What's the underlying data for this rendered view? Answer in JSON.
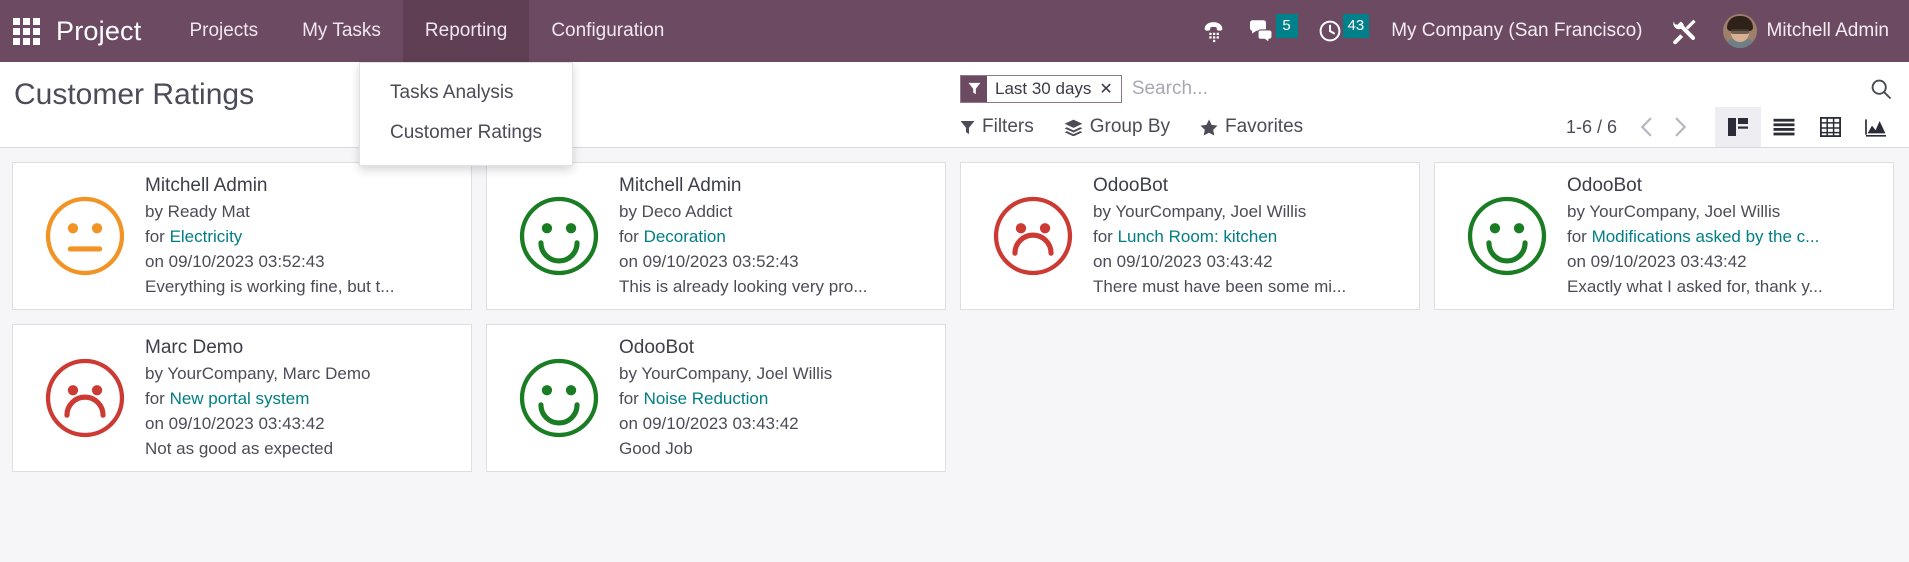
{
  "navbar": {
    "apps_icon": "apps-grid-icon",
    "brand": "Project",
    "menus": [
      {
        "label": "Projects",
        "active": false
      },
      {
        "label": "My Tasks",
        "active": false
      },
      {
        "label": "Reporting",
        "active": true
      },
      {
        "label": "Configuration",
        "active": false
      }
    ],
    "systray": {
      "voip_icon": "phone-dialpad-icon",
      "messages_icon": "chat-bubbles-icon",
      "messages_count": "5",
      "activities_icon": "clock-icon",
      "activities_count": "43",
      "company": "My Company (San Francisco)",
      "debug_icon": "tools-wrench-icon",
      "username": "Mitchell Admin",
      "avatar_icon": "user-avatar"
    },
    "accent_color": "#6c4a61",
    "active_menu_color": "#5e3f54",
    "badge_color": "#00808a"
  },
  "dropdown": {
    "open_for": "Reporting",
    "items": [
      {
        "label": "Tasks Analysis"
      },
      {
        "label": "Customer Ratings"
      }
    ]
  },
  "control_panel": {
    "breadcrumb": "Customer Ratings",
    "search": {
      "facet_icon": "filter-funnel-icon",
      "facet_label": "Last 30 days",
      "facet_close_icon": "close-x-icon",
      "value": "",
      "placeholder": "Search...",
      "search_icon": "magnifier-icon"
    },
    "dropdowns": [
      {
        "label": "Filters",
        "icon": "filter-funnel-icon"
      },
      {
        "label": "Group By",
        "icon": "layers-stack-icon"
      },
      {
        "label": "Favorites",
        "icon": "star-icon"
      }
    ],
    "pager": {
      "value": "1-6 / 6",
      "prev_icon": "chevron-left-icon",
      "next_icon": "chevron-right-icon"
    },
    "views": [
      {
        "name": "kanban",
        "icon": "kanban-view-icon",
        "active": true
      },
      {
        "name": "list",
        "icon": "list-view-icon",
        "active": false
      },
      {
        "name": "pivot",
        "icon": "pivot-table-icon",
        "active": false
      },
      {
        "name": "graph",
        "icon": "graph-area-icon",
        "active": false
      }
    ]
  },
  "kanban": {
    "cards": [
      {
        "rating": "neutral",
        "rating_color": "#f29325",
        "name": "Mitchell Admin",
        "by": "by Ready Mat",
        "for_prefix": "for ",
        "for_link": "Electricity",
        "on": "on 09/10/2023 03:52:43",
        "feedback": "Everything is working fine, but t..."
      },
      {
        "rating": "happy",
        "rating_color": "#1a7d23",
        "name": "Mitchell Admin",
        "by": "by Deco Addict",
        "for_prefix": "for ",
        "for_link": "Decoration",
        "on": "on 09/10/2023 03:52:43",
        "feedback": "This is already looking very pro..."
      },
      {
        "rating": "sad",
        "rating_color": "#cc3b33",
        "name": "OdooBot",
        "by": "by YourCompany, Joel Willis",
        "for_prefix": "for ",
        "for_link": "Lunch Room: kitchen",
        "on": "on 09/10/2023 03:43:42",
        "feedback": "There must have been some mi..."
      },
      {
        "rating": "happy",
        "rating_color": "#1a7d23",
        "name": "OdooBot",
        "by": "by YourCompany, Joel Willis",
        "for_prefix": "for ",
        "for_link": "Modifications asked by the c...",
        "on": "on 09/10/2023 03:43:42",
        "feedback": "Exactly what I asked for, thank y..."
      },
      {
        "rating": "sad",
        "rating_color": "#cc3b33",
        "name": "Marc Demo",
        "by": "by YourCompany, Marc Demo",
        "for_prefix": "for ",
        "for_link": "New portal system",
        "on": "on 09/10/2023 03:43:42",
        "feedback": "Not as good as expected"
      },
      {
        "rating": "happy",
        "rating_color": "#1a7d23",
        "name": "OdooBot",
        "by": "by YourCompany, Joel Willis",
        "for_prefix": "for ",
        "for_link": "Noise Reduction",
        "on": "on 09/10/2023 03:43:42",
        "feedback": "Good Job"
      }
    ]
  }
}
